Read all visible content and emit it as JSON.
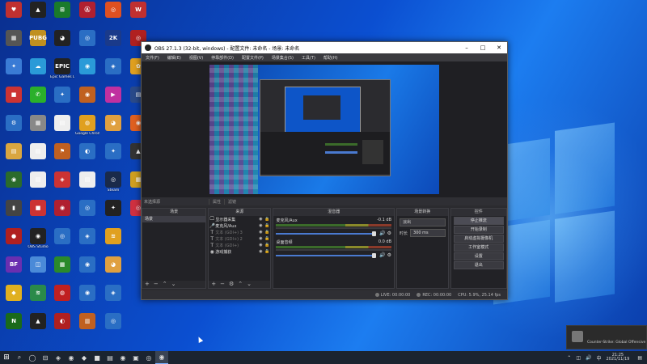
{
  "desktop_icons": [
    {
      "label": "",
      "glyph": "♥",
      "color": "#c03030"
    },
    {
      "label": "",
      "glyph": "▦",
      "color": "#555"
    },
    {
      "label": "",
      "glyph": "✦",
      "color": "#3a7bd5"
    },
    {
      "label": "",
      "glyph": "■",
      "color": "#c33"
    },
    {
      "label": "",
      "glyph": "⚙",
      "color": "#2a6ec4"
    },
    {
      "label": "",
      "glyph": "▤",
      "color": "#d9a640"
    },
    {
      "label": "",
      "glyph": "◉",
      "color": "#2b6b2b"
    },
    {
      "label": "",
      "glyph": "▮",
      "color": "#444"
    },
    {
      "label": "",
      "glyph": "●",
      "color": "#b02020"
    },
    {
      "label": "",
      "glyph": "BF",
      "color": "#6a2fb0"
    },
    {
      "label": "",
      "glyph": "◆",
      "color": "#e0b020"
    },
    {
      "label": "",
      "glyph": "N",
      "color": "#1a6a1a"
    },
    {
      "label": "",
      "glyph": "▲",
      "color": "#222"
    },
    {
      "label": "",
      "glyph": "PUBG",
      "color": "#c09020"
    },
    {
      "label": "",
      "glyph": "☁",
      "color": "#2a9ad8"
    },
    {
      "label": "",
      "glyph": "✆",
      "color": "#2ab02a"
    },
    {
      "label": "",
      "glyph": "▦",
      "color": "#888"
    },
    {
      "label": "",
      "glyph": "▤",
      "color": "#eee"
    },
    {
      "label": "",
      "glyph": "▤",
      "color": "#eee"
    },
    {
      "label": "",
      "glyph": "■",
      "color": "#c33"
    },
    {
      "label": "OBS Studio",
      "glyph": "◉",
      "color": "#222"
    },
    {
      "label": "",
      "glyph": "◫",
      "color": "#4a8ad8"
    },
    {
      "label": "",
      "glyph": "≋",
      "color": "#2a8a4a"
    },
    {
      "label": "",
      "glyph": "▲",
      "color": "#222"
    },
    {
      "label": "",
      "glyph": "⊞",
      "color": "#1a7a2a"
    },
    {
      "label": "",
      "glyph": "◕",
      "color": "#222"
    },
    {
      "label": "Epic Games Launcher",
      "glyph": "EPIC",
      "color": "#222"
    },
    {
      "label": "",
      "glyph": "✦",
      "color": "#2a6ec4"
    },
    {
      "label": "",
      "glyph": "▤",
      "color": "#eee"
    },
    {
      "label": "",
      "glyph": "⚑",
      "color": "#c06020"
    },
    {
      "label": "",
      "glyph": "◈",
      "color": "#c33"
    },
    {
      "label": "",
      "glyph": "◉",
      "color": "#b02030"
    },
    {
      "label": "",
      "glyph": "◎",
      "color": "#2a6ec4"
    },
    {
      "label": "",
      "glyph": "▦",
      "color": "#2a8a2a"
    },
    {
      "label": "",
      "glyph": "◍",
      "color": "#c02020"
    },
    {
      "label": "",
      "glyph": "◐",
      "color": "#b02020"
    },
    {
      "label": "",
      "glyph": "Ⓐ",
      "color": "#b02030"
    },
    {
      "label": "",
      "glyph": "◎",
      "color": "#2a6ec4"
    },
    {
      "label": "",
      "glyph": "◉",
      "color": "#2a9ad8"
    },
    {
      "label": "",
      "glyph": "◉",
      "color": "#c06020"
    },
    {
      "label": "Google Chrome",
      "glyph": "◍",
      "color": "#e0a020"
    },
    {
      "label": "",
      "glyph": "◐",
      "color": "#2a6ec4"
    },
    {
      "label": "",
      "glyph": "▤",
      "color": "#eee"
    },
    {
      "label": "",
      "glyph": "◎",
      "color": "#2a6ec4"
    },
    {
      "label": "",
      "glyph": "◈",
      "color": "#2a6ec4"
    },
    {
      "label": "",
      "glyph": "◉",
      "color": "#2a6ec4"
    },
    {
      "label": "",
      "glyph": "◉",
      "color": "#2a6ec4"
    },
    {
      "label": "",
      "glyph": "▥",
      "color": "#c06020"
    },
    {
      "label": "",
      "glyph": "◎",
      "color": "#e05020"
    },
    {
      "label": "",
      "glyph": "2K",
      "color": "#1a3a8a"
    },
    {
      "label": "",
      "glyph": "◈",
      "color": "#2a6ec4"
    },
    {
      "label": "",
      "glyph": "▶",
      "color": "#c030a0"
    },
    {
      "label": "",
      "glyph": "◕",
      "color": "#e0a040"
    },
    {
      "label": "",
      "glyph": "✦",
      "color": "#2a6ec4"
    },
    {
      "label": "Steam",
      "glyph": "◎",
      "color": "#1a2a4a"
    },
    {
      "label": "",
      "glyph": "✦",
      "color": "#222"
    },
    {
      "label": "",
      "glyph": "≋",
      "color": "#e0a020"
    },
    {
      "label": "",
      "glyph": "◕",
      "color": "#e0a040"
    },
    {
      "label": "",
      "glyph": "◈",
      "color": "#2a6ec4"
    },
    {
      "label": "",
      "glyph": "◎",
      "color": "#2a6ec4"
    },
    {
      "label": "",
      "glyph": "W",
      "color": "#c03030"
    },
    {
      "label": "",
      "glyph": "◎",
      "color": "#b02020"
    },
    {
      "label": "",
      "glyph": "✿",
      "color": "#e0a020"
    },
    {
      "label": "",
      "glyph": "▤",
      "color": "#2a4a8a"
    },
    {
      "label": "",
      "glyph": "◉",
      "color": "#e06020"
    },
    {
      "label": "",
      "glyph": "▲",
      "color": "#333"
    },
    {
      "label": "",
      "glyph": "▦",
      "color": "#d0a020"
    },
    {
      "label": "",
      "glyph": "◎",
      "color": "#d03040"
    }
  ],
  "obs": {
    "title": "OBS 27.1.3 (32-bit, windows) - 配置文件: 未命名 - 场景: 未命名",
    "menu": [
      "文件(F)",
      "编辑(E)",
      "视图(V)",
      "停靠部件(D)",
      "配置文件(P)",
      "场景集合(S)",
      "工具(T)",
      "帮助(H)"
    ],
    "scene_bar": {
      "label": "未选择源",
      "tab1": "属性",
      "tab2": "滤镜"
    },
    "docks": {
      "scenes": {
        "title": "场景",
        "items": [
          "场景"
        ]
      },
      "sources": {
        "title": "来源",
        "items": [
          {
            "icon": "🖵",
            "label": "显示器采集",
            "enabled": true
          },
          {
            "icon": "🎤",
            "label": "麦克风/Aux",
            "enabled": true
          },
          {
            "icon": "T",
            "label": "文本 (GDI+) 3",
            "enabled": false
          },
          {
            "icon": "T",
            "label": "文本 (GDI+) 2",
            "enabled": false
          },
          {
            "icon": "T",
            "label": "文本 (GDI+)",
            "enabled": false
          },
          {
            "icon": "◉",
            "label": "游戏捕获",
            "enabled": true
          }
        ]
      },
      "mixer": {
        "title": "混音器",
        "channels": [
          {
            "name": "麦克风/Aux",
            "db": "-0.1 dB"
          },
          {
            "name": "桌面音频",
            "db": "0.0 dB"
          }
        ]
      },
      "transitions": {
        "title": "场景转换",
        "type": "淡出",
        "duration_label": "时长",
        "duration": "300 ms"
      },
      "controls": {
        "title": "控件",
        "buttons": [
          "停止推流",
          "开始录制",
          "启动虚拟摄像机",
          "工作室模式",
          "设置",
          "退出"
        ]
      }
    },
    "status": {
      "live": "LIVE: 00:00:00",
      "rec": "REC: 00:00:00",
      "cpu": "CPU: 5.9%, 25.14 fps"
    }
  },
  "notification": {
    "title": "",
    "line1": "",
    "line2": "Counter-Strike: Global Offensive"
  },
  "taskbar": {
    "apps": [
      "⌕",
      "◯",
      "⊟",
      "◈",
      "◉",
      "◆",
      "■",
      "▤",
      "◉",
      "▣",
      "◎",
      "◉"
    ],
    "time": "21:25",
    "date": "2021/11/19"
  }
}
